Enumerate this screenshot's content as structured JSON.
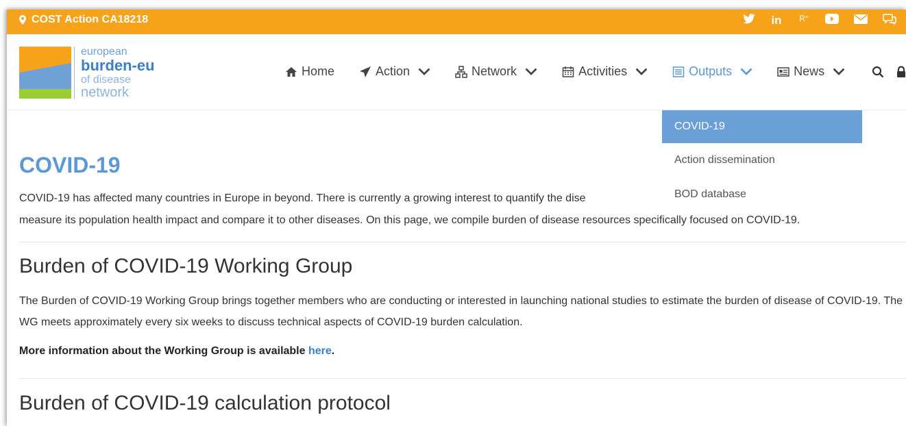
{
  "topbar": {
    "location": "COST Action CA18218",
    "socials": [
      "twitter-icon",
      "linkedin-icon",
      "researchgate-icon",
      "youtube-icon",
      "mail-icon",
      "chat-icon"
    ],
    "linkedin_label": "in",
    "researchgate_label": "R°"
  },
  "logo": {
    "line1": "european",
    "line2": "burden-eu",
    "line3": "of disease",
    "line4": "network"
  },
  "nav": {
    "items": [
      {
        "label": "Home",
        "icon": "home-icon"
      },
      {
        "label": "Action",
        "icon": "paper-plane-icon"
      },
      {
        "label": "Network",
        "icon": "sitemap-icon"
      },
      {
        "label": "Activities",
        "icon": "calendar-icon"
      },
      {
        "label": "Outputs",
        "icon": "list-alt-icon"
      },
      {
        "label": "News",
        "icon": "newspaper-icon"
      }
    ]
  },
  "dropdown": {
    "items": [
      "COVID-19",
      "Action dissemination",
      "BOD database"
    ]
  },
  "content": {
    "title": "COVID-19",
    "intro_line1": "COVID-19 has affected many countries in Europe in beyond. There is currently a growing interest to quantify the dise",
    "intro_line2": "measure its population health impact and compare it to other diseases. On this page, we compile burden of disease resources specifically focused on COVID-19.",
    "wg_title": "Burden of COVID-19 Working Group",
    "wg_text": "The Burden of COVID-19 Working Group brings together members who are conducting or interested in launching national studies to estimate the burden of disease of COVID-19. The WG meets approximately every six weeks to discuss technical aspects of COVID-19 burden calculation.",
    "more_info_prefix": "More information about the Working Group is available ",
    "more_info_link": "here",
    "more_info_suffix": ".",
    "protocol_title": "Burden of COVID-19 calculation protocol"
  },
  "colors": {
    "topbar": "#f7a21b",
    "accent_blue": "#5e97d6",
    "dropdown_active": "#6a9fd8",
    "logo_green": "#9acd32"
  }
}
